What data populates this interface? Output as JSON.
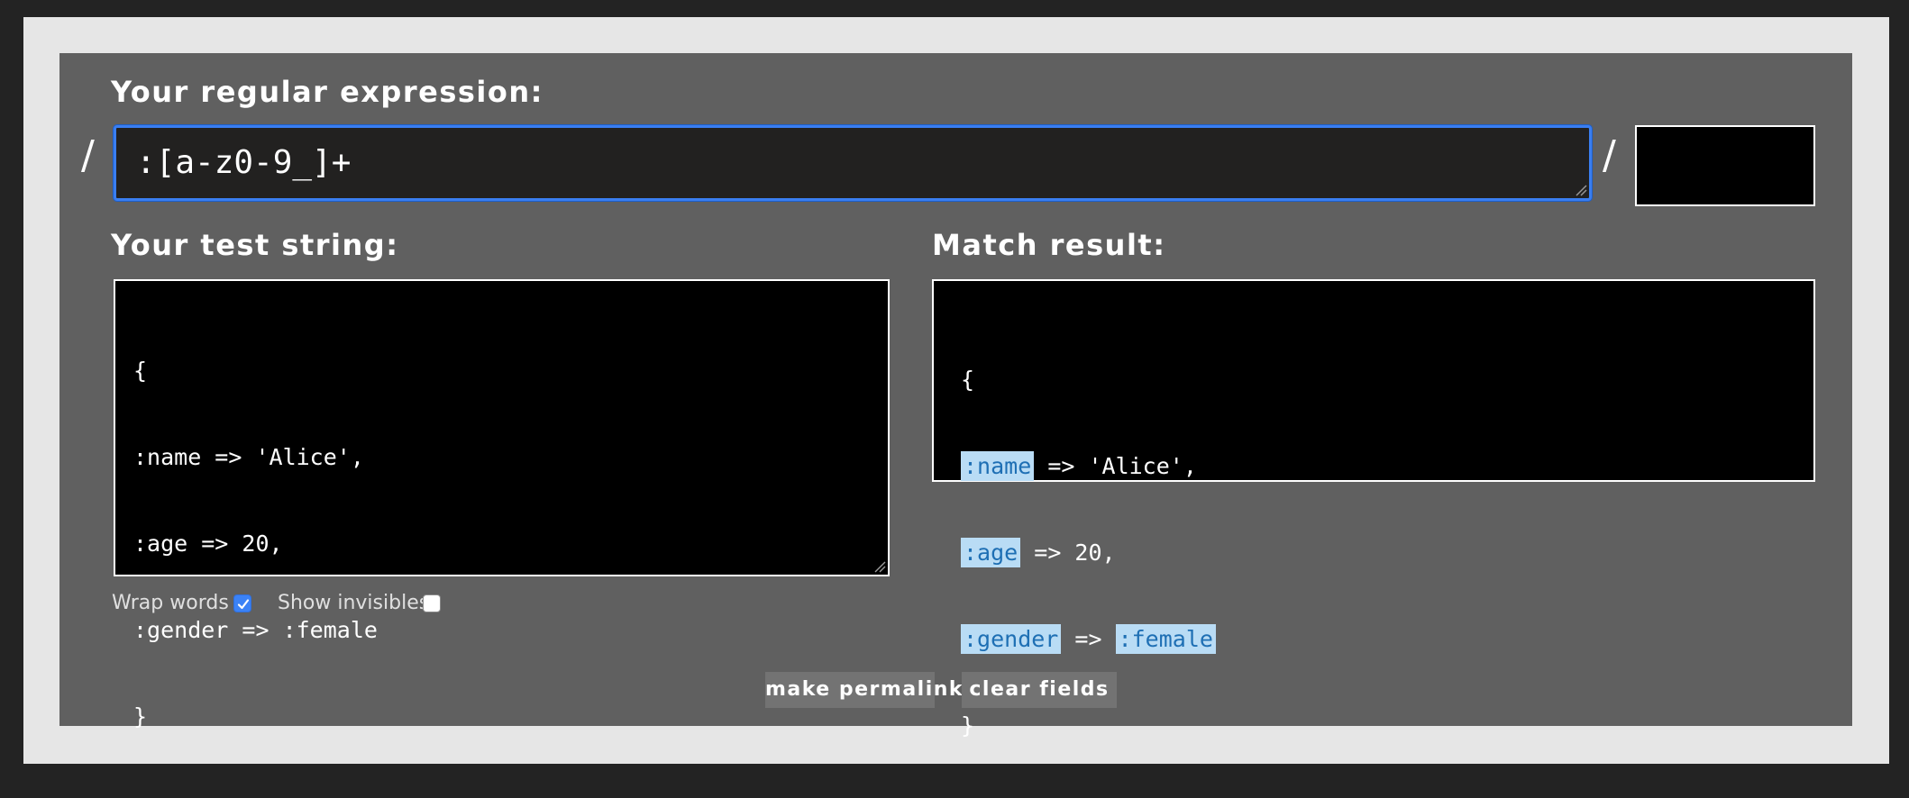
{
  "regex": {
    "heading": "Your regular expression:",
    "left_delimiter": "/",
    "right_delimiter": "/",
    "value": ":[a-z0-9_]+",
    "flags_value": ""
  },
  "test": {
    "heading": "Your test string:",
    "lines": [
      "{",
      ":name => 'Alice',",
      ":age => 20,",
      ":gender => :female",
      "}"
    ]
  },
  "result": {
    "heading": "Match result:",
    "line1": "{",
    "line2": {
      "match": ":name",
      "rest": " => 'Alice',"
    },
    "line3": {
      "match": ":age",
      "rest": " => 20,"
    },
    "line4": {
      "match1": ":gender",
      "mid": " => ",
      "match2": ":female"
    },
    "line5": "}",
    "highlight_bg": "#b9dcf5",
    "highlight_fg": "#1e6fb4"
  },
  "options": {
    "wrap_words": {
      "label": "Wrap words",
      "checked": true
    },
    "show_invisibles": {
      "label": "Show invisibles",
      "checked": false
    }
  },
  "buttons": {
    "permalink": "make permalink",
    "clear": "clear fields"
  },
  "colors": {
    "background": "#232323",
    "frame": "#e6e6e6",
    "panel": "#606060",
    "focus_border": "#3a7ef0"
  }
}
